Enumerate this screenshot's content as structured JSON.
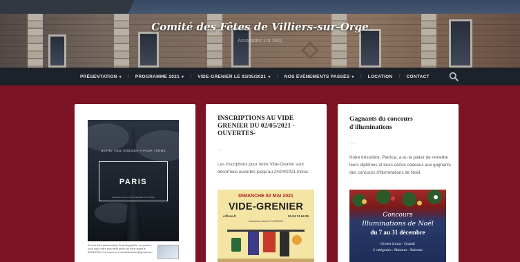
{
  "site": {
    "title": "Comité des Fêtes de Villiers-sur-Orge",
    "tagline": "Association Loi 1901"
  },
  "nav": {
    "items": [
      {
        "label": "PRÉSENTATION",
        "dropdown": true
      },
      {
        "label": "PROGRAMME 2021",
        "dropdown": true
      },
      {
        "label": "VIDE-GRENIER LE 02/05/2021",
        "dropdown": true
      },
      {
        "label": "NOS ÉVÈNEMENTS PASSÉS",
        "dropdown": true
      },
      {
        "label": "LOCATION",
        "dropdown": false
      },
      {
        "label": "CONTACT",
        "dropdown": false
      }
    ],
    "separator": "/",
    "caret": "▾",
    "search_icon": "search-icon"
  },
  "posts": [
    {
      "image": {
        "headline": "NOTRE VIDE GRENIER A POUR THÈME",
        "city": "PARIS",
        "subline": "Déguisez-vous et venez déguisés à nos côtés",
        "footer": "Si vous êtes passionné(e) de photographie, surprenez-nous avec votre plus belle photo de Paris avant le 30/04/2021 et envoyez-la à comitedesfetes@gmail.com"
      }
    },
    {
      "title": "INSCRIPTIONS AU VIDE GRENIER DU 02/05/2021 - OUVERTES-",
      "excerpt": "Les inscriptions pour notre Vide-Grenier sont désormais ouvertes jusqu'au 24/04/2021 inclus",
      "image": {
        "date": "DIMANCHE 02 MAI 2021",
        "title": "VIDE-GRENIER",
        "site": "cdfvso.fr",
        "phone": "06 04 74 64 05",
        "note": "Inscriptions avant le 24/04/2021"
      }
    },
    {
      "title": "Gagnants du concours d'illuminations",
      "excerpt": "Notre trésorière, Patricia, a eu le plaisir de remettre leurs diplômes et leurs cartes cadeaux aux gagnants des concours d'illuminations de Noël.",
      "image": {
        "line1": "Concours",
        "line2": "Illuminations de Noël",
        "dates": "du 7 au 31 décembre",
        "line3": "Ouvert à tous - Gratuit",
        "line4": "2 catégories : Maisons - Balcons"
      }
    }
  ],
  "colors": {
    "background": "#7d1426",
    "nav": "#1d2129",
    "card": "#ffffff"
  }
}
